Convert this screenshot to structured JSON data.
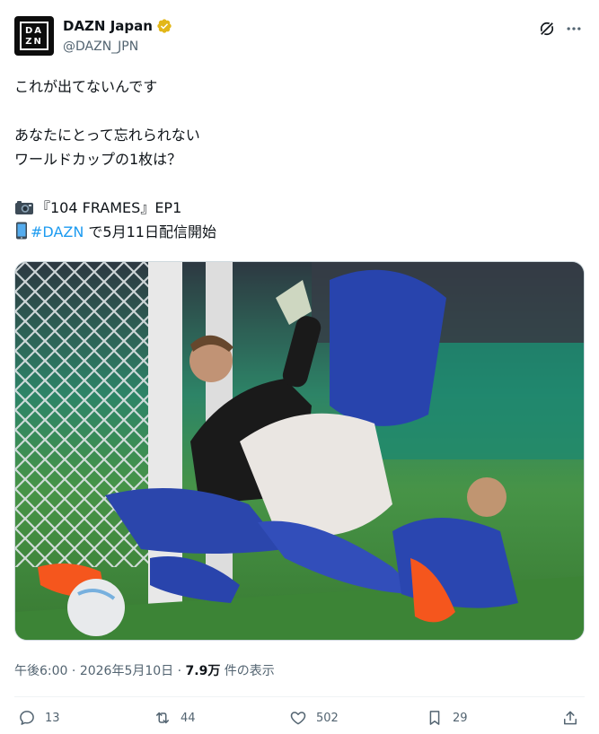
{
  "author": {
    "display_name": "DAZN Japan",
    "handle": "@DAZN_JPN",
    "avatar_text": "DA\nZN"
  },
  "post": {
    "lines": {
      "l1": "これが出てないんです",
      "l2": "あなたにとって忘れられない",
      "l3": "ワールドカップの1枚は？",
      "l4": "『104 FRAMES』EP1",
      "l5_hashtag": "#DAZN",
      "l5_rest": " で5月11日配信開始"
    }
  },
  "meta": {
    "time": "午後6:00",
    "sep1": " · ",
    "date": "2026年5月10日",
    "sep2": " · ",
    "views": "7.9万",
    "views_suffix": " 件の表示"
  },
  "actions": {
    "reply": "13",
    "repost": "44",
    "like": "502",
    "bookmark": "29"
  },
  "colors": {
    "accent": "#1d9bf0",
    "verified": "#e2b719",
    "japan_blue": "#2845b8",
    "spain_black": "#1a1a1a",
    "pitch": "#3c8a3c"
  }
}
